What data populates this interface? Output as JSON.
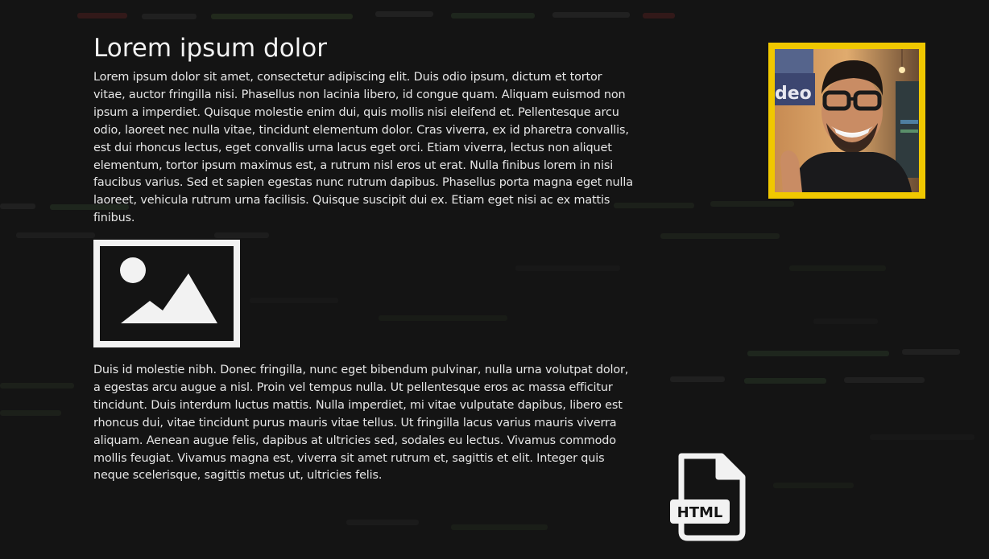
{
  "title": "Lorem ipsum dolor",
  "paragraphs": [
    "Lorem ipsum dolor sit amet, consectetur adipiscing elit. Duis odio ipsum, dictum et tortor vitae, auctor fringilla nisi. Phasellus non lacinia libero, id congue quam. Aliquam euismod non ipsum a imperdiet. Quisque molestie enim dui, quis mollis nisi eleifend et. Pellentesque arcu odio, laoreet nec nulla vitae, tincidunt elementum dolor. Cras viverra, ex id pharetra convallis, est dui rhoncus lectus, eget convallis urna lacus eget orci. Etiam viverra, lectus non aliquet elementum, tortor ipsum maximus est, a rutrum nisl eros ut erat. Nulla finibus lorem in nisi faucibus varius. Sed et sapien egestas nunc rutrum dapibus. Phasellus porta magna eget nulla laoreet, vehicula rutrum urna facilisis. Quisque suscipit dui ex. Etiam eget nisi ac ex mattis finibus.",
    "Duis id molestie nibh. Donec fringilla, nunc eget bibendum pulvinar, nulla urna volutpat dolor, a egestas arcu augue a nisl. Proin vel tempus nulla. Ut pellentesque eros ac massa efficitur tincidunt. Duis interdum luctus mattis. Nulla imperdiet, mi vitae vulputate dapibus, libero est rhoncus dui, vitae tincidunt purus mauris vitae tellus. Ut fringilla lacus varius mauris viverra aliquam. Aenean augue felis, dapibus at ultricies sed, sodales eu lectus. Vivamus commodo mollis feugiat. Vivamus magna est, viverra sit amet rutrum et, sagittis et elit. Integer quis neque scelerisque, sagittis metus ut, ultricies felis."
  ],
  "webcam": {
    "background_sign_text": "deo",
    "frame_color": "#f0c800"
  },
  "file_icon": {
    "label": "HTML",
    "icon": "html-file-icon"
  },
  "image_icon": "image-placeholder-icon",
  "colors": {
    "background": "#141414",
    "text": "#e6e6e6",
    "icon": "#f2f2f2"
  }
}
